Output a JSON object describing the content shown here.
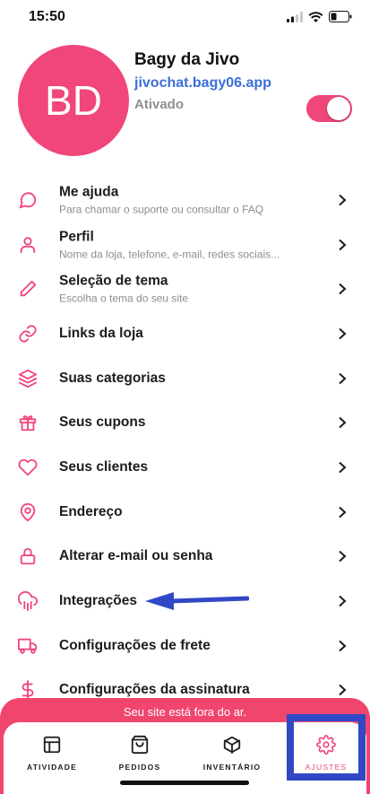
{
  "status_bar": {
    "time": "15:50"
  },
  "profile": {
    "avatar_initials": "BD",
    "store_name": "Bagy da Jivo",
    "store_url": "jivochat.bagy06.app",
    "status_label": "Ativado",
    "toggle_on": true
  },
  "menu": {
    "items": [
      {
        "title": "Me ajuda",
        "subtitle": "Para chamar o suporte ou consultar o FAQ",
        "icon": "chat-bubble-icon"
      },
      {
        "title": "Perfil",
        "subtitle": "Nome da loja, telefone, e-mail, redes sociais...",
        "icon": "user-icon"
      },
      {
        "title": "Seleção de tema",
        "subtitle": "Escolha o tema do seu site",
        "icon": "pencil-icon"
      },
      {
        "title": "Links da loja",
        "subtitle": "",
        "icon": "link-icon"
      },
      {
        "title": "Suas categorias",
        "subtitle": "",
        "icon": "layers-icon"
      },
      {
        "title": "Seus cupons",
        "subtitle": "",
        "icon": "gift-icon"
      },
      {
        "title": "Seus clientes",
        "subtitle": "",
        "icon": "heart-icon"
      },
      {
        "title": "Endereço",
        "subtitle": "",
        "icon": "map-pin-icon"
      },
      {
        "title": "Alterar e-mail ou senha",
        "subtitle": "",
        "icon": "lock-icon"
      },
      {
        "title": "Integrações",
        "subtitle": "",
        "icon": "cloud-rain-icon"
      },
      {
        "title": "Configurações de frete",
        "subtitle": "",
        "icon": "truck-icon"
      },
      {
        "title": "Configurações da assinatura",
        "subtitle": "",
        "icon": "dollar-icon"
      }
    ]
  },
  "offline_banner": "Seu site está fora do ar.",
  "tabbar": {
    "tabs": [
      {
        "label": "ATIVIDADE",
        "icon": "layout-icon"
      },
      {
        "label": "PEDIDOS",
        "icon": "shopping-bag-icon"
      },
      {
        "label": "INVENTÁRIO",
        "icon": "box-icon"
      },
      {
        "label": "AJUSTES",
        "icon": "settings-icon",
        "active": true
      }
    ]
  },
  "colors": {
    "accent": "#f0467a",
    "link": "#3b6fd8",
    "annotation": "#3148c6"
  }
}
